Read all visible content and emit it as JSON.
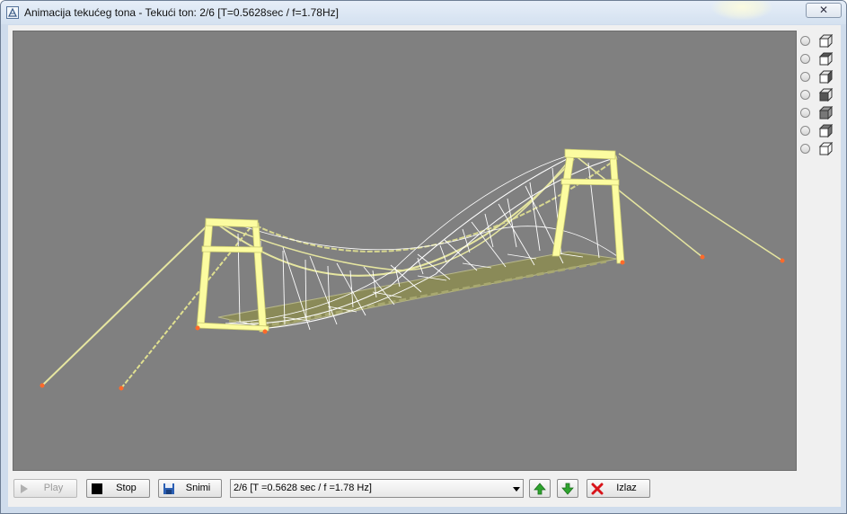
{
  "window": {
    "title": "Animacija tekućeg tona - Tekući ton: 2/6 [T=0.5628sec / f=1.78Hz]",
    "close_glyph": "✕"
  },
  "viewport": {
    "background": "#808080",
    "model": "suspension-bridge",
    "colors": {
      "tower": "#fcfca0",
      "cable": "#e6e6a0",
      "hanger": "#ffffff",
      "deck": "#8a8a58",
      "support": "#ff6a2a"
    }
  },
  "view_options": [
    {
      "icon": "cube-view-icon",
      "selected": false
    },
    {
      "icon": "cube-view-icon",
      "selected": false
    },
    {
      "icon": "cube-view-icon",
      "selected": false
    },
    {
      "icon": "cube-view-icon",
      "selected": false
    },
    {
      "icon": "cube-view-icon",
      "selected": false
    },
    {
      "icon": "cube-view-icon",
      "selected": false
    },
    {
      "icon": "cube-view-icon",
      "selected": false
    }
  ],
  "toolbar": {
    "play_label": "Play",
    "stop_label": "Stop",
    "save_label": "Snimi",
    "mode_select_value": "2/6 [T =0.5628 sec / f =1.78 Hz]",
    "up_icon": "arrow-up-icon",
    "down_icon": "arrow-down-icon",
    "exit_label": "Izlaz"
  }
}
